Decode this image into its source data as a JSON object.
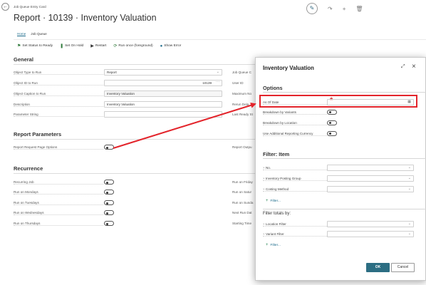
{
  "page": {
    "breadcrumb": "Job Queue Entry Card",
    "title": "Report · 10139 · Inventory Valuation",
    "nav": [
      "Home",
      "Job Queue"
    ],
    "actions": [
      {
        "label": "Set Status to Ready",
        "icon": "status-icon"
      },
      {
        "label": "Set On Hold",
        "icon": "hold-icon"
      },
      {
        "label": "Restart",
        "icon": "play-icon"
      },
      {
        "label": "Run once (foreground)",
        "icon": "run-icon"
      },
      {
        "label": "Show Error",
        "icon": "error-icon"
      }
    ]
  },
  "general": {
    "heading": "General",
    "fields": [
      {
        "label": "Object Type to Run",
        "value": "Report"
      },
      {
        "label": "Object ID to Run",
        "value": "10139"
      },
      {
        "label": "Object Caption to Run",
        "value": "Inventory Valuation"
      },
      {
        "label": "Description",
        "value": "Inventory Valuation"
      },
      {
        "label": "Parameter String",
        "value": ""
      }
    ],
    "right_labels": [
      "Job Queue C",
      "User ID",
      "Maximum No",
      "Rerun Dela",
      "Last Ready St"
    ]
  },
  "report_params": {
    "heading": "Report Parameters",
    "label": "Report Request Page Options",
    "right_label": "Report Outpu"
  },
  "recurrence": {
    "heading": "Recurrence",
    "fields": [
      "Recurring Job",
      "Run on Mondays",
      "Run on Tuesdays",
      "Run on Wednesdays",
      "Run on Thursdays"
    ],
    "right_labels": [
      "Run on Friday",
      "Run on Satur",
      "Run on Sunda",
      "Next Run Dat",
      "Starting Time"
    ]
  },
  "dialog": {
    "title": "Inventory Valuation",
    "options_heading": "Options",
    "as_of_date_label": "As Of Date",
    "as_of_date_value": "",
    "breakdown_variants": "Breakdown by Variants",
    "breakdown_location": "Breakdown by Location",
    "use_additional_currency": "Use Additional Reporting Currency",
    "filter_item_heading": "Filter: Item",
    "filter_item_rows": [
      "No.",
      "Inventory Posting Group",
      "Costing Method"
    ],
    "filter_link": "Filter...",
    "filter_totals_heading": "Filter totals by:",
    "filter_totals_rows": [
      "Location Filter",
      "Variant Filter"
    ],
    "ok": "OK",
    "cancel": "Cancel"
  },
  "colors": {
    "accent": "#2c6e83",
    "highlight": "#e3242b",
    "required": "#d42a2a"
  }
}
